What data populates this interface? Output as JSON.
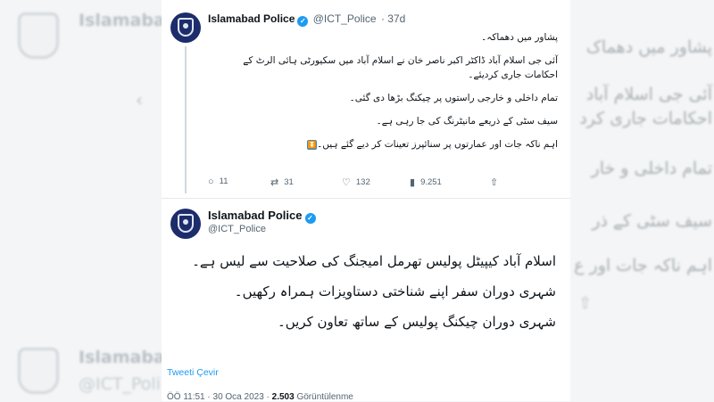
{
  "background": {
    "author_name": "Islamabad",
    "author_name_bottom": "Islamabad",
    "handle_bottom": "@ICT_Poli",
    "lines": [
      "پشاور میں دھماک",
      "آئی جی اسلام آباد",
      "احکامات جاری کرد",
      "تمام داخلی و خار",
      "سیف سٹی کے ذر",
      "اہم ناکہ جات اور ع"
    ]
  },
  "quoted_tweet": {
    "author": "Islamabad Police",
    "handle": "@ICT_Police",
    "time": "· 37d",
    "body": [
      "پشاور میں دھماکہ۔",
      "آئی جی اسلام آباد ڈاکٹر اکبر ناصر خان نے اسلام آباد میں سکیورٹی ہائی الرٹ کے احکامات جاری کردیئے۔",
      "تمام داخلی و خارجی راستوں پر چیکنگ بڑھا دی گئی۔",
      "سیف سٹی کے ذریعے مانیٹرنگ کی جا رہی ہے۔",
      "اہم ناکہ جات اور عمارتوں پر سنائپرز تعینات کر دیے گئے ہیں۔"
    ],
    "emoji": "⏬",
    "stats": {
      "replies": "11",
      "retweets": "31",
      "likes": "132",
      "views": "9.251"
    }
  },
  "main_tweet": {
    "author": "Islamabad Police",
    "handle": "@ICT_Police",
    "body": [
      "اسلام آباد کیپیٹل پولیس تھرمل امیجنگ کی صلاحیت سے لیس ہے۔",
      "شہری دوران سفر اپنے شناختی دستاویزات ہمراہ رکھیں۔",
      "شہری دوران چیکنگ پولیس کے ساتھ تعاون کریں۔"
    ],
    "translate_label": "Tweeti Çevir",
    "meta_time": "ÖÖ 11:51 · 30 Oca 2023 · ",
    "meta_views_count": "2.503",
    "meta_views_label": " Görüntülenme"
  },
  "colors": {
    "accent": "#1d9bf0",
    "verified": "#1d9bf0",
    "avatar": "#1d2c6b"
  },
  "icons": {
    "reply": "reply-icon",
    "retweet": "retweet-icon",
    "like": "heart-icon",
    "views": "views-icon",
    "share": "share-icon",
    "verified": "verified-badge-icon"
  }
}
